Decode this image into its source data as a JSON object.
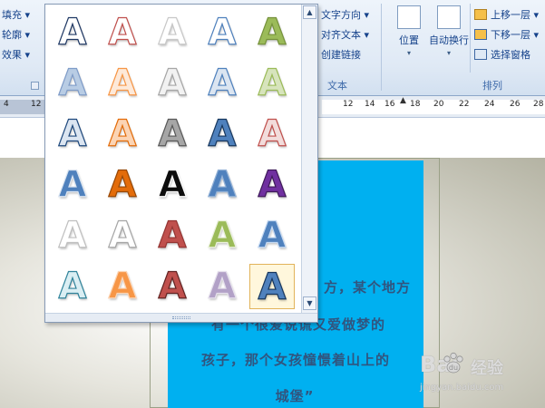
{
  "ribbon": {
    "shape_style": {
      "fill": "填充",
      "outline": "轮廓",
      "effects": "效果"
    },
    "text_group": {
      "direction": "文字方向",
      "align": "对齐文本",
      "link": "创建链接",
      "label": "文本"
    },
    "arrange_group": {
      "position": "位置",
      "wrap": "自动换行",
      "bring_forward": "上移一层",
      "send_backward": "下移一层",
      "selection_pane": "选择窗格",
      "label": "排列"
    }
  },
  "ruler": {
    "ticks_left": [
      "4",
      "12"
    ],
    "ticks_right": [
      "12",
      "14",
      "16",
      "18",
      "20",
      "22",
      "24",
      "26",
      "28"
    ]
  },
  "gallery": {
    "glyph": "A",
    "rows": [
      [
        {
          "fill": "#ffffff",
          "stroke": "#1f3864"
        },
        {
          "fill": "#ffffff",
          "stroke": "#c0504d"
        },
        {
          "fill": "#ffffff",
          "stroke": "#c8c8c8"
        },
        {
          "fill": "#ffffff",
          "stroke": "#4f81bd"
        },
        {
          "fill": "#9bbb59",
          "stroke": "#76923c"
        }
      ],
      [
        {
          "fill": "#b8cce4",
          "stroke": "#7f9cc8"
        },
        {
          "fill": "#fde9d9",
          "stroke": "#f79646"
        },
        {
          "fill": "#f2f2f2",
          "stroke": "#a6a6a6"
        },
        {
          "fill": "#dbe5f1",
          "stroke": "#4f81bd"
        },
        {
          "fill": "#d7e4bc",
          "stroke": "#9bbb59"
        }
      ],
      [
        {
          "fill": "#dbe5f1",
          "stroke": "#1f497d"
        },
        {
          "fill": "#fbd4b4",
          "stroke": "#e36c0a"
        },
        {
          "fill": "#a6a6a6",
          "stroke": "#595959"
        },
        {
          "fill": "#4f81bd",
          "stroke": "#17375e"
        },
        {
          "fill": "#f2dcdb",
          "stroke": "#c0504d"
        }
      ],
      [
        {
          "fill": "#4f81bd",
          "stroke": "#dbe5f1"
        },
        {
          "fill": "#e36c0a",
          "stroke": "#974806"
        },
        {
          "fill": "#0d0d0d",
          "stroke": "#ffffff"
        },
        {
          "fill": "#4f81bd",
          "stroke": "#95b3d7"
        },
        {
          "fill": "#7030a0",
          "stroke": "#3f1a5a"
        }
      ],
      [
        {
          "fill": "#ffffff",
          "stroke": "#bfbfbf"
        },
        {
          "fill": "#ffffff",
          "stroke": "#a6a6a6"
        },
        {
          "fill": "#c0504d",
          "stroke": "#943634"
        },
        {
          "fill": "#9bbb59",
          "stroke": "#ebf1dd"
        },
        {
          "fill": "#4f81bd",
          "stroke": "#c6d9f1"
        }
      ],
      [
        {
          "fill": "#daeef3",
          "stroke": "#31849b"
        },
        {
          "fill": "#f79646",
          "stroke": "#fbd4b4"
        },
        {
          "fill": "#c0504d",
          "stroke": "#632423"
        },
        {
          "fill": "#b2a1c7",
          "stroke": "#e5e0ec"
        },
        {
          "fill": "#4f81bd",
          "stroke": "#17375e"
        }
      ]
    ]
  },
  "document": {
    "lines": [
      "方，某个地方",
      "有一个很爱说谎又爱做梦的",
      "孩子，那个女孩憧憬着山上的",
      "城堡”"
    ]
  },
  "watermark": {
    "brand": "Bai",
    "brand2": "经验",
    "url": "jingyan.baidu.com"
  },
  "colors": {
    "textbox_fill": "#00b0f0",
    "ribbon_bg": "#dfe9f5",
    "selected_cell_border": "#e2b35a"
  }
}
